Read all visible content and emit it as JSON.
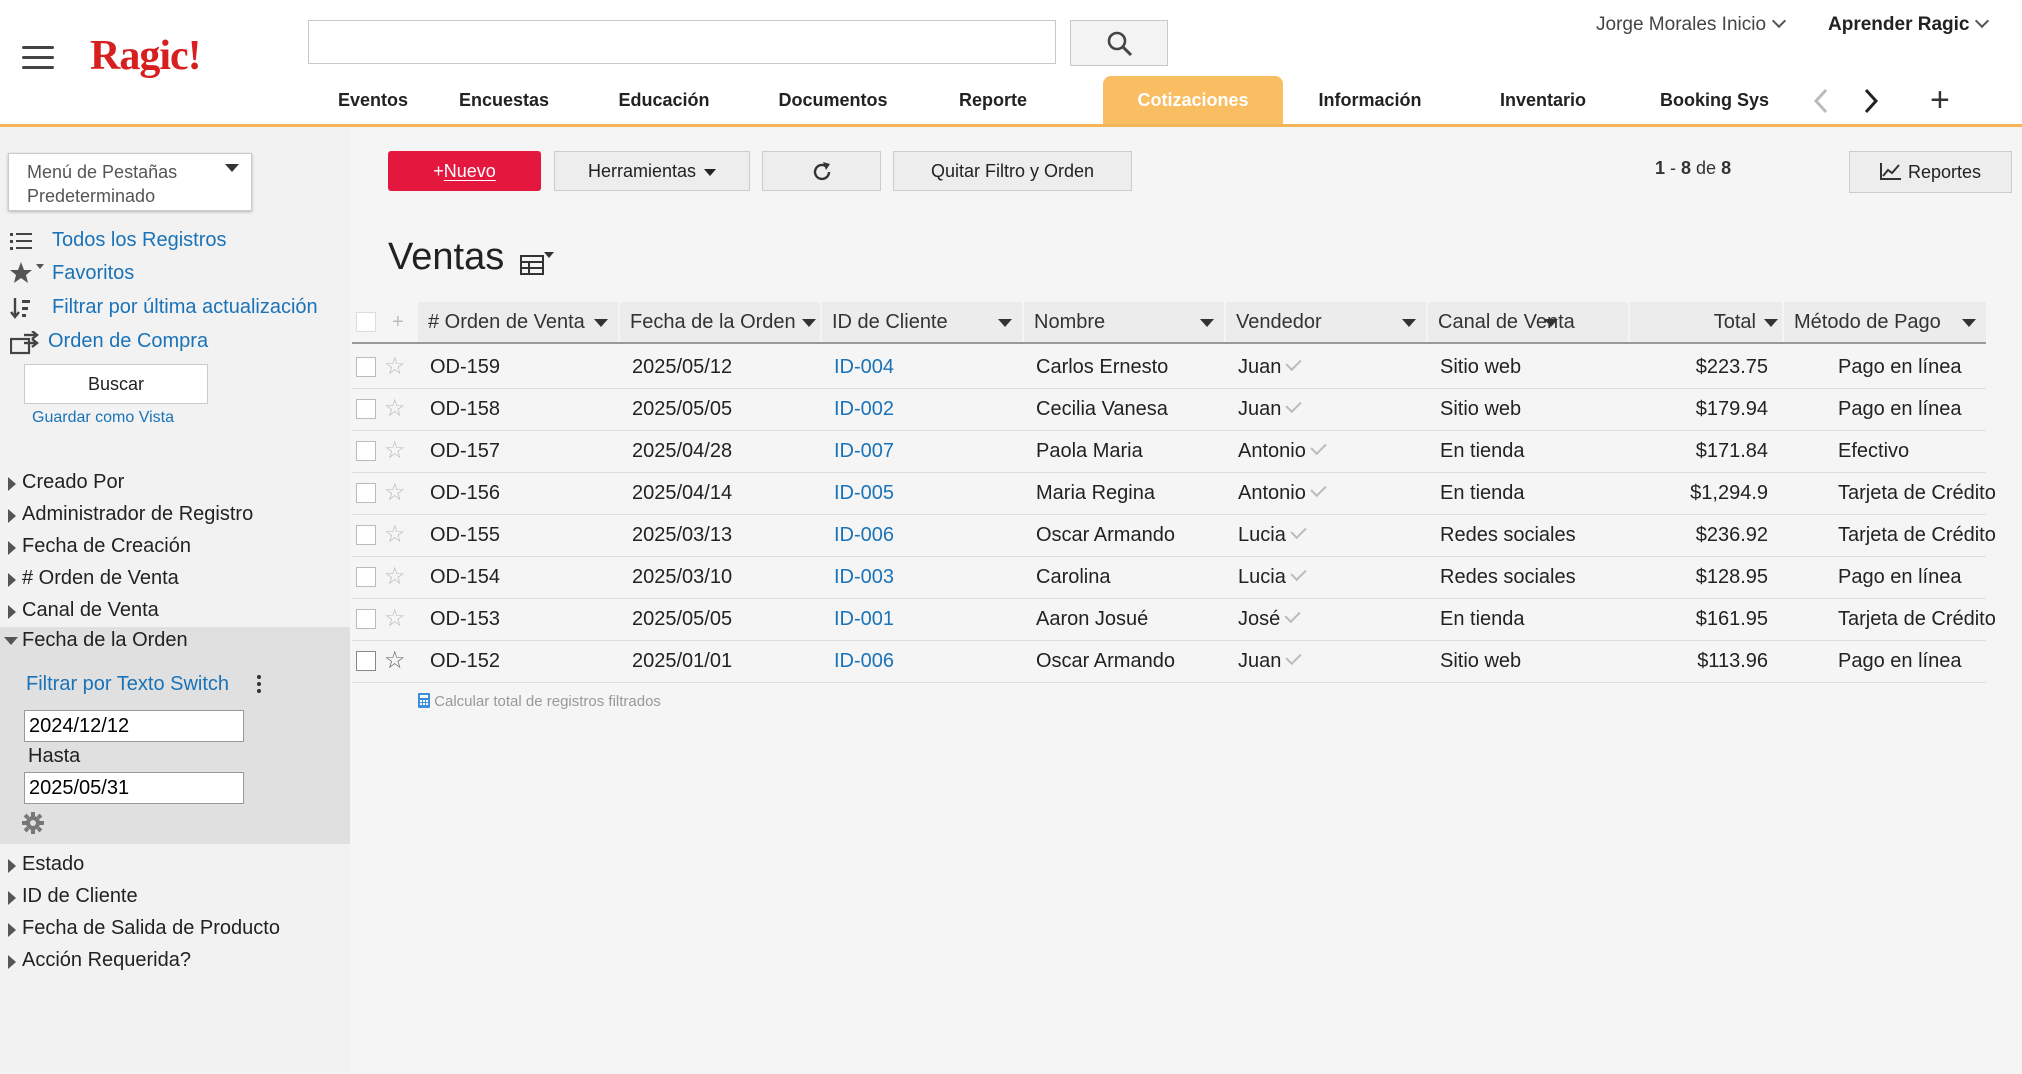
{
  "header": {
    "logo": "Ragic!",
    "search_placeholder": "",
    "user_menu": "Jorge Morales Inicio",
    "learn_menu": "Aprender Ragic",
    "tabs": [
      "Eventos",
      "Encuestas",
      "Educación",
      "Documentos",
      "Reporte",
      "Cotizaciones",
      "Información",
      "Inventario",
      "Booking Sys"
    ],
    "active_tab": "Cotizaciones",
    "add_tab": "+"
  },
  "sidebar": {
    "tab_menu": "Menú de Pestañas Predeterminado",
    "links": {
      "all_records": "Todos los Registros",
      "favorites": "Favoritos",
      "last_update": "Filtrar por última actualización",
      "purchase_order": "Orden de Compra"
    },
    "search_button": "Buscar",
    "save_view": "Guardar como Vista",
    "filters_top": [
      "Creado Por",
      "Administrador de Registro",
      "Fecha de Creación",
      "# Orden de Venta",
      "Canal de Venta"
    ],
    "expanded_filter": {
      "label": "Fecha de la Orden",
      "switch_link": "Filtrar por Texto Switch",
      "from": "2024/12/12",
      "to_label": "Hasta",
      "to": "2025/05/31"
    },
    "filters_bottom": [
      "Estado",
      "ID de Cliente",
      "Fecha de Salida de Producto",
      "Acción Requerida?"
    ]
  },
  "toolbar": {
    "new_prefix": "+",
    "new_label": "Nuevo",
    "tools_label": "Herramientas",
    "clear_label": "Quitar Filtro y Orden",
    "pager": {
      "from": "1",
      "to": "8",
      "of_word": "de",
      "total": "8"
    },
    "reports_label": "Reportes"
  },
  "main": {
    "title": "Ventas",
    "columns": [
      "# Orden de Venta",
      "Fecha de la Orden",
      "ID de Cliente",
      "Nombre",
      "Vendedor",
      "Canal de Venta",
      "Total",
      "Método de Pago"
    ],
    "rows": [
      [
        "OD-159",
        "2025/05/12",
        "ID-004",
        "Carlos Ernesto",
        "Juan",
        "Sitio web",
        "$223.75",
        "Pago en línea"
      ],
      [
        "OD-158",
        "2025/05/05",
        "ID-002",
        "Cecilia Vanesa",
        "Juan",
        "Sitio web",
        "$179.94",
        "Pago en línea"
      ],
      [
        "OD-157",
        "2025/04/28",
        "ID-007",
        "Paola Maria",
        "Antonio",
        "En tienda",
        "$171.84",
        "Efectivo"
      ],
      [
        "OD-156",
        "2025/04/14",
        "ID-005",
        "Maria Regina",
        "Antonio",
        "En tienda",
        "$1,294.9",
        "Tarjeta de Crédito"
      ],
      [
        "OD-155",
        "2025/03/13",
        "ID-006",
        "Oscar Armando",
        "Lucia",
        "Redes sociales",
        "$236.92",
        "Tarjeta de Crédito"
      ],
      [
        "OD-154",
        "2025/03/10",
        "ID-003",
        "Carolina",
        "Lucia",
        "Redes sociales",
        "$128.95",
        "Pago en línea"
      ],
      [
        "OD-153",
        "2025/05/05",
        "ID-001",
        "Aaron Josué",
        "José",
        "En tienda",
        "$161.95",
        "Tarjeta de Crédito"
      ],
      [
        "OD-152",
        "2025/01/01",
        "ID-006",
        "Oscar Armando",
        "Juan",
        "Sitio web",
        "$113.96",
        "Pago en línea"
      ]
    ],
    "calc_link": "Calcular total de registros filtrados"
  },
  "colors": {
    "accent": "#f9bd62",
    "brand": "#d71f1f",
    "new_button": "#e4173f",
    "link": "#1a73b8"
  }
}
